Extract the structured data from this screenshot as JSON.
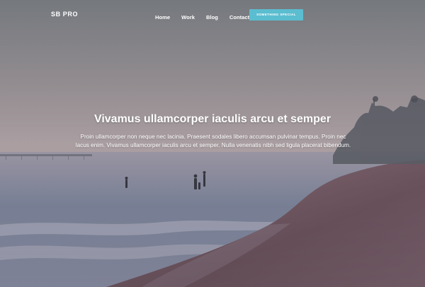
{
  "navbar": {
    "brand": "SB PRO",
    "links": [
      {
        "label": "Home"
      },
      {
        "label": "Work"
      },
      {
        "label": "Blog"
      },
      {
        "label": "Contact"
      }
    ],
    "cta_label": "Something Special"
  },
  "hero": {
    "headline": "Vivamus ullamcorper iaculis arcu et semper",
    "lead": "Proin ullamcorper non neque nec lacinia. Praesent sodales libero accumsan pulvinar tempus. Proin nec lacus enim. Vivamus ullamcorper iaculis arcu et semper. Nulla venenatis nibh sed ligula placerat bibendum."
  },
  "colors": {
    "accent": "#5bbdd0",
    "text": "#ffffff",
    "sky_top": "#80848a",
    "sky_bottom": "#a89ba0",
    "sand": "#7a5e68",
    "water": "#7e8aa0"
  }
}
